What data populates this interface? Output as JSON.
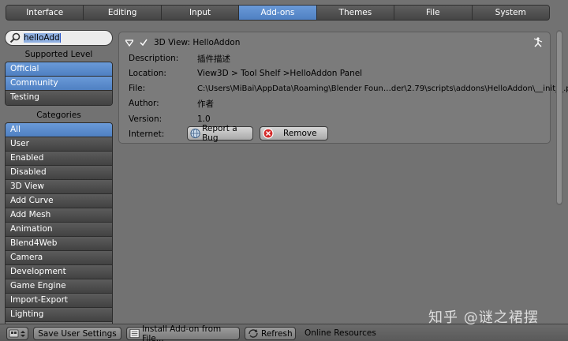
{
  "tabs": [
    "Interface",
    "Editing",
    "Input",
    "Add-ons",
    "Themes",
    "File",
    "System"
  ],
  "active_tab": "Add-ons",
  "sidebar": {
    "search_value": "helloAdd",
    "supported_level_label": "Supported Level",
    "levels": [
      {
        "label": "Official",
        "active": true
      },
      {
        "label": "Community",
        "active": true
      },
      {
        "label": "Testing",
        "active": false
      }
    ],
    "categories_label": "Categories",
    "categories": [
      {
        "label": "All",
        "active": true
      },
      {
        "label": "User"
      },
      {
        "label": "Enabled"
      },
      {
        "label": "Disabled"
      },
      {
        "label": "3D View"
      },
      {
        "label": "Add Curve"
      },
      {
        "label": "Add Mesh"
      },
      {
        "label": "Animation"
      },
      {
        "label": "Blend4Web"
      },
      {
        "label": "Camera"
      },
      {
        "label": "Development"
      },
      {
        "label": "Game Engine"
      },
      {
        "label": "Import-Export"
      },
      {
        "label": "Lighting"
      }
    ]
  },
  "addon": {
    "title": "3D View: HelloAddon",
    "enabled": true,
    "fields": [
      {
        "key": "Description:",
        "value": "插件描述"
      },
      {
        "key": "Location:",
        "value": "View3D > Tool Shelf >HelloAddon Panel"
      },
      {
        "key": "File:",
        "value": "C:\\Users\\MiBai\\AppData\\Roaming\\Blender Foun…der\\2.79\\scripts\\addons\\HelloAddon\\__init__.py"
      },
      {
        "key": "Author:",
        "value": "作者"
      },
      {
        "key": "Version:",
        "value": "1.0"
      }
    ],
    "internet_label": "Internet:",
    "report_bug_label": "Report a Bug",
    "remove_label": "Remove"
  },
  "bottom": {
    "save_label": "Save User Settings",
    "install_label": "Install Add-on from File...",
    "refresh_label": "Refresh",
    "online_label": "Online Resources"
  },
  "watermark": "知乎 @谜之裙摆",
  "colors": {
    "background": "#727272",
    "active_blue": "#5a8bcf",
    "button_dark": "#4c4c4c"
  }
}
